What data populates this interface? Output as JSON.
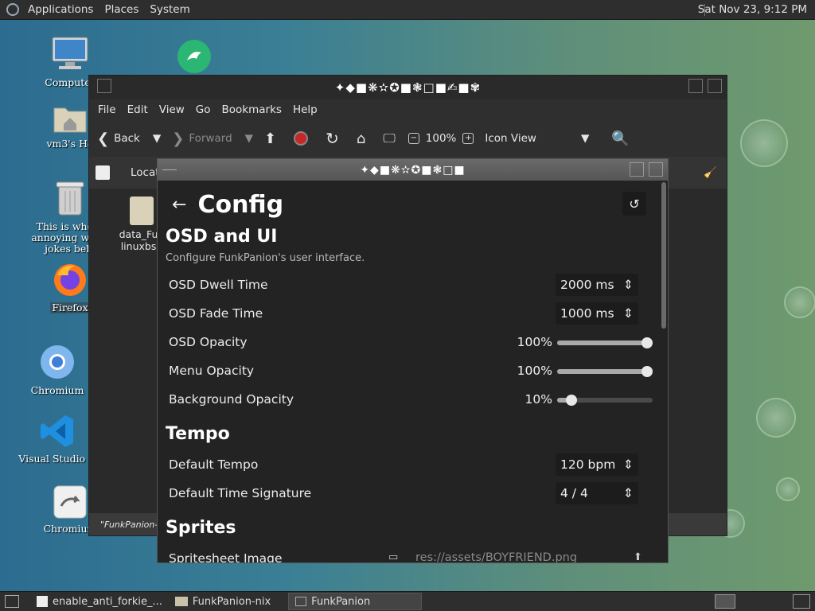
{
  "top_panel": {
    "menus": [
      "Applications",
      "Places",
      "System"
    ],
    "clock": "Sat Nov 23,  9:12 PM"
  },
  "desktop_icons": [
    {
      "label": "Computer",
      "icon": "computer-icon"
    },
    {
      "label": "vm3's Ho",
      "icon": "home-folder-icon"
    },
    {
      "label": "This is where annoying wat... jokes belo",
      "icon": "trash-icon"
    },
    {
      "label": "Firefox",
      "icon": "firefox-icon"
    },
    {
      "label": "Chromium",
      "icon": "chromium-icon"
    },
    {
      "label": "Visual Studio C",
      "icon": "vscode-icon"
    },
    {
      "label": "Chromium",
      "icon": "chromium-web-icon"
    }
  ],
  "file_manager": {
    "title": "✦◆■❋✫✪■❃□■✍■✾",
    "menus": [
      "File",
      "Edit",
      "View",
      "Go",
      "Bookmarks",
      "Help"
    ],
    "toolbar": {
      "back": "Back",
      "forward": "Forward",
      "zoom": "100%",
      "view_mode": "Icon View"
    },
    "location_label": "Locat",
    "file_label": "data_Fun linuxbsd",
    "status": "\"FunkPanion-"
  },
  "config": {
    "window_title": "✦◆■❋✫✪■❃□■",
    "heading": "Config",
    "sections": [
      {
        "title": "OSD and UI",
        "description": "Configure FunkPanion's user interface."
      },
      {
        "title": "Tempo"
      },
      {
        "title": "Sprites"
      }
    ],
    "osd_dwell": {
      "label": "OSD Dwell Time",
      "value": "2000 ms"
    },
    "osd_fade": {
      "label": "OSD Fade Time",
      "value": "1000 ms"
    },
    "osd_opacity": {
      "label": "OSD Opacity",
      "value": "100%",
      "level": 1.0
    },
    "menu_opacity": {
      "label": "Menu Opacity",
      "value": "100%",
      "level": 1.0
    },
    "bg_opacity": {
      "label": "Background Opacity",
      "value": "10%",
      "level": 0.1
    },
    "default_tempo": {
      "label": "Default Tempo",
      "value": "120 bpm"
    },
    "default_timesig": {
      "label": "Default Time Signature",
      "value": "4 / 4"
    },
    "spritesheet": {
      "label": "Spritesheet Image",
      "value": "res://assets/BOYFRIEND.png"
    }
  },
  "taskbar": {
    "tasks": [
      {
        "label": "enable_anti_forkie_...",
        "icon": "text-editor-icon"
      },
      {
        "label": "FunkPanion-nix",
        "icon": "folder-icon"
      },
      {
        "label": "FunkPanion",
        "icon": "app-window-icon"
      }
    ]
  },
  "colors": {
    "accent": "#a8a8a8",
    "panel": "#2e2e2e",
    "window_bg": "#232323"
  }
}
